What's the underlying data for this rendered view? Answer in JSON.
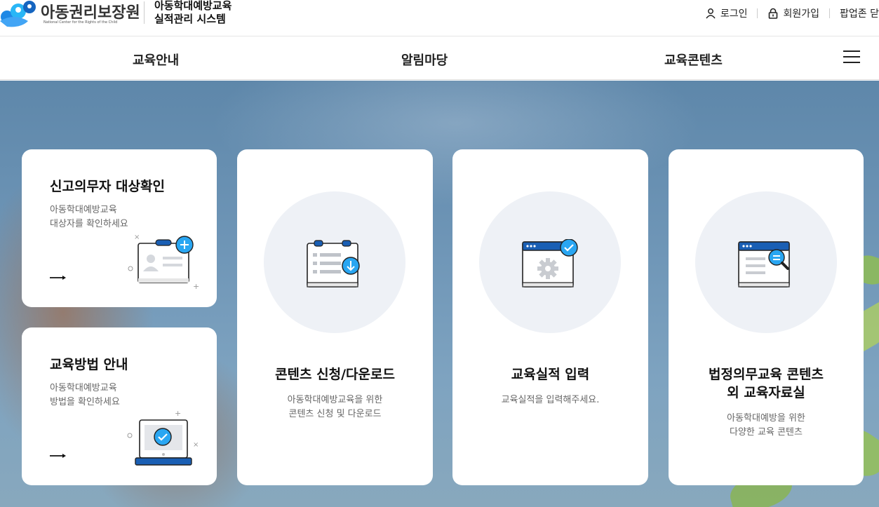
{
  "header": {
    "logo_name": "아동권리보장원",
    "logo_sub": "National Center for the Rights of the Child",
    "system_title_line1": "아동학대예방교육",
    "system_title_line2": "실적관리 시스템",
    "util": {
      "login": "로그인",
      "signup": "회원가입",
      "popup_zone": "팝업존 닫"
    }
  },
  "gnb": {
    "items": [
      "교육안내",
      "알림마당",
      "교육콘텐츠"
    ]
  },
  "cards": {
    "reporter_check": {
      "title": "신고의무자 대상확인",
      "desc_line1": "아동학대예방교육",
      "desc_line2": "대상자를 확인하세요"
    },
    "edu_method": {
      "title": "교육방법 안내",
      "desc_line1": "아동학대예방교육",
      "desc_line2": "방법을 확인하세요"
    },
    "content_download": {
      "title": "콘텐츠 신청/다운로드",
      "desc_line1": "아동학대예방교육을 위한",
      "desc_line2": "콘텐츠 신청 및 다운로드"
    },
    "edu_record": {
      "title": "교육실적 입력",
      "desc_line1": "교육실적을 입력해주세요."
    },
    "legal_content": {
      "title_line1": "법정의무교육 콘텐츠",
      "title_line2": "외 교육자료실",
      "desc_line1": "아동학대예방을 위한",
      "desc_line2": "다양한 교육 콘텐츠"
    }
  },
  "colors": {
    "accent_blue": "#1a73e8",
    "icon_blue": "#2196f3",
    "dark_blue": "#1a5fb4",
    "circle_bg": "#eef1f6"
  }
}
